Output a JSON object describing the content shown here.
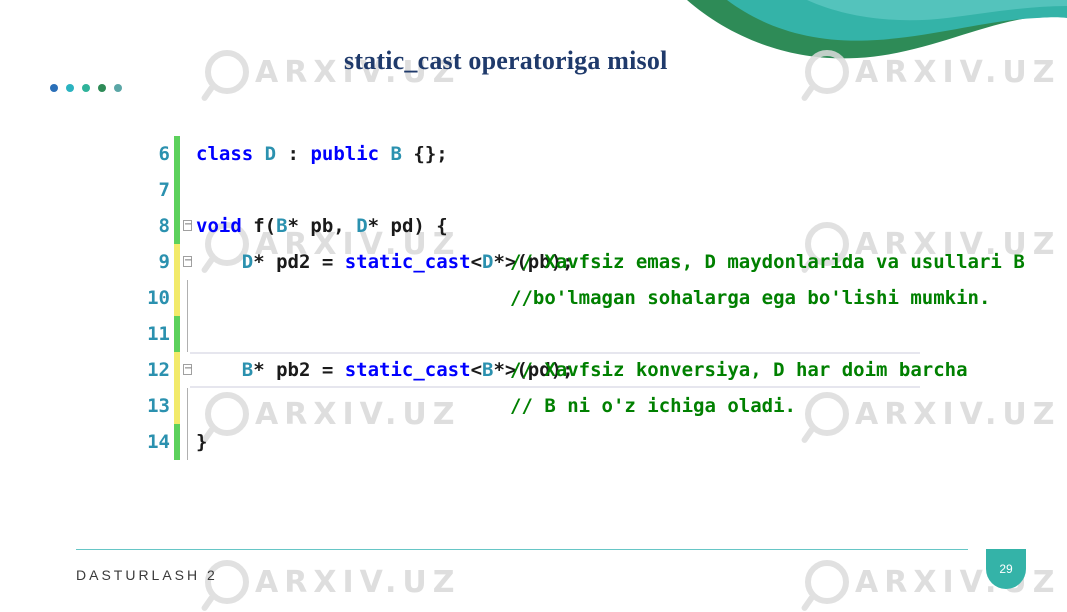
{
  "slide": {
    "title": "static_cast operatoriga misol",
    "footer": "DASTURLASH 2",
    "page_number": "29",
    "watermark_text": "ARXIV.UZ"
  },
  "colors": {
    "title": "#1f3a6b",
    "accent_teal": "#34b3a8",
    "accent_green": "#2e8b57",
    "dots": [
      "#2a6fb8",
      "#2bb3c0",
      "#2fb39a",
      "#2e8b57",
      "#5aa6a6"
    ],
    "gutter_saved": "#5cd15c",
    "gutter_changed": "#f2ea6a",
    "keyword": "#0000ff",
    "type": "#2b91af",
    "comment": "#008000"
  },
  "code": {
    "lines": [
      {
        "num": "6",
        "parts": [
          {
            "t": "class",
            "c": "kw"
          },
          {
            "t": " "
          },
          {
            "t": "D",
            "c": "ty"
          },
          {
            "t": " : "
          },
          {
            "t": "public",
            "c": "kw"
          },
          {
            "t": " "
          },
          {
            "t": "B",
            "c": "ty"
          },
          {
            "t": " {};"
          }
        ],
        "comment": ""
      },
      {
        "num": "7",
        "parts": [],
        "comment": ""
      },
      {
        "num": "8",
        "parts": [
          {
            "t": "void",
            "c": "kw"
          },
          {
            "t": " f("
          },
          {
            "t": "B",
            "c": "ty"
          },
          {
            "t": "* pb, "
          },
          {
            "t": "D",
            "c": "ty"
          },
          {
            "t": "* pd) {"
          }
        ],
        "comment": ""
      },
      {
        "num": "9",
        "parts": [
          {
            "t": "    "
          },
          {
            "t": "D",
            "c": "ty"
          },
          {
            "t": "* pd2 = "
          },
          {
            "t": "static_cast",
            "c": "kw"
          },
          {
            "t": "<"
          },
          {
            "t": "D",
            "c": "ty"
          },
          {
            "t": "*>(pb);"
          }
        ],
        "comment": "// Xavfsiz emas, D maydonlarida va usullari B"
      },
      {
        "num": "10",
        "parts": [],
        "comment": "//bo'lmagan sohalarga ega bo'lishi mumkin."
      },
      {
        "num": "11",
        "parts": [],
        "comment": ""
      },
      {
        "num": "12",
        "parts": [
          {
            "t": "    "
          },
          {
            "t": "B",
            "c": "ty"
          },
          {
            "t": "* pb2 = "
          },
          {
            "t": "static_cast",
            "c": "kw"
          },
          {
            "t": "<"
          },
          {
            "t": "B",
            "c": "ty"
          },
          {
            "t": "*>(pd);"
          }
        ],
        "comment": "// Xavfsiz konversiya, D har doim barcha"
      },
      {
        "num": "13",
        "parts": [],
        "comment": "// B ni o'z ichiga oladi."
      },
      {
        "num": "14",
        "parts": [
          {
            "t": "}"
          }
        ],
        "comment": ""
      }
    ]
  }
}
